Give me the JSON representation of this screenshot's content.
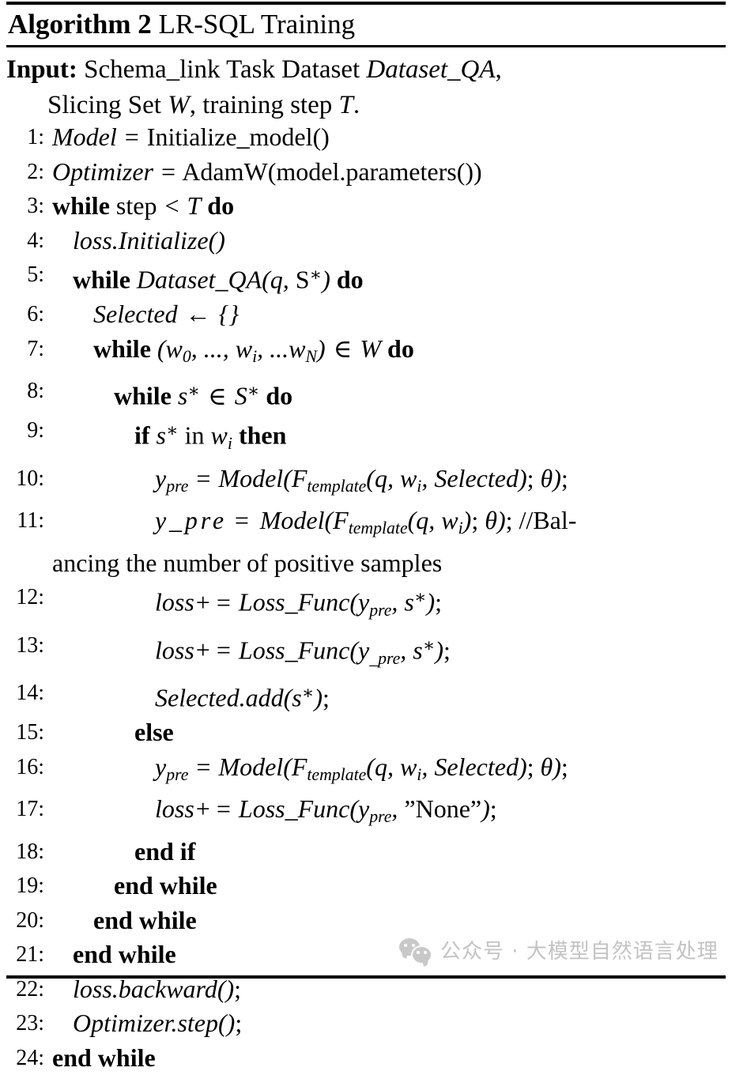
{
  "document": {
    "type": "algorithm-pseudocode",
    "background_color": "#ffffff",
    "text_color": "#000000"
  },
  "header": {
    "keyword": "Algorithm",
    "number": "2",
    "title": "LR-SQL Training"
  },
  "input": {
    "label": "Input:",
    "line1_plain": "Schema_link Task Dataset ",
    "line1_math": "Dataset_QA",
    "line1_tail": ",",
    "line2_a": "Slicing Set ",
    "line2_w": "W",
    "line2_b": ", training step ",
    "line2_t": "T",
    "line2_end": "."
  },
  "lines": [
    {
      "n": "1:",
      "indent": 0,
      "text": "Model = Initialize_model()"
    },
    {
      "n": "2:",
      "indent": 0,
      "text": "Optimizer = AdamW(model.parameters())"
    },
    {
      "n": "3:",
      "indent": 0,
      "text": "while step < T do"
    },
    {
      "n": "4:",
      "indent": 1,
      "text": "loss.Initialize()"
    },
    {
      "n": "5:",
      "indent": 1,
      "text": "while Dataset_QA(q, S*) do"
    },
    {
      "n": "6:",
      "indent": 2,
      "text": "Selected ← {}"
    },
    {
      "n": "7:",
      "indent": 2,
      "text": "while (w0, ..., wi, ...wN) ∈ W do"
    },
    {
      "n": "8:",
      "indent": 3,
      "text": "while s* ∈ S* do"
    },
    {
      "n": "9:",
      "indent": 4,
      "text": "if s* in wi then"
    },
    {
      "n": "10:",
      "indent": 5,
      "text": "ypre = Model(Ftemplate(q, wi, Selected); θ);"
    },
    {
      "n": "11:",
      "indent": 5,
      "text": "y_pre = Model(Ftemplate(q, wi); θ);  //Bal-",
      "continuation": "ancing the number of positive samples"
    },
    {
      "n": "12:",
      "indent": 5,
      "text": "loss+ = Loss_Func(ypre, s*);"
    },
    {
      "n": "13:",
      "indent": 5,
      "text": "loss+ = Loss_Func(y_pre, s*);"
    },
    {
      "n": "14:",
      "indent": 5,
      "text": "Selected.add(s*);"
    },
    {
      "n": "15:",
      "indent": 4,
      "text": "else"
    },
    {
      "n": "16:",
      "indent": 5,
      "text": "ypre = Model(Ftemplate(q, wi, Selected); θ);"
    },
    {
      "n": "17:",
      "indent": 5,
      "text": "loss+ = Loss_Func(ypre, \"None\");"
    },
    {
      "n": "18:",
      "indent": 4,
      "text": "end if"
    },
    {
      "n": "19:",
      "indent": 3,
      "text": "end while"
    },
    {
      "n": "20:",
      "indent": 2,
      "text": "end while"
    },
    {
      "n": "21:",
      "indent": 1,
      "text": "end while"
    },
    {
      "n": "22:",
      "indent": 1,
      "text": "loss.backward();"
    },
    {
      "n": "23:",
      "indent": 1,
      "text": "Optimizer.step();"
    },
    {
      "n": "24:",
      "indent": 0,
      "text": "end while"
    }
  ],
  "watermark": {
    "text": "公众号 · 大模型自然语言处理",
    "icon": "wechat-icon",
    "color": "#c3c3c3"
  }
}
